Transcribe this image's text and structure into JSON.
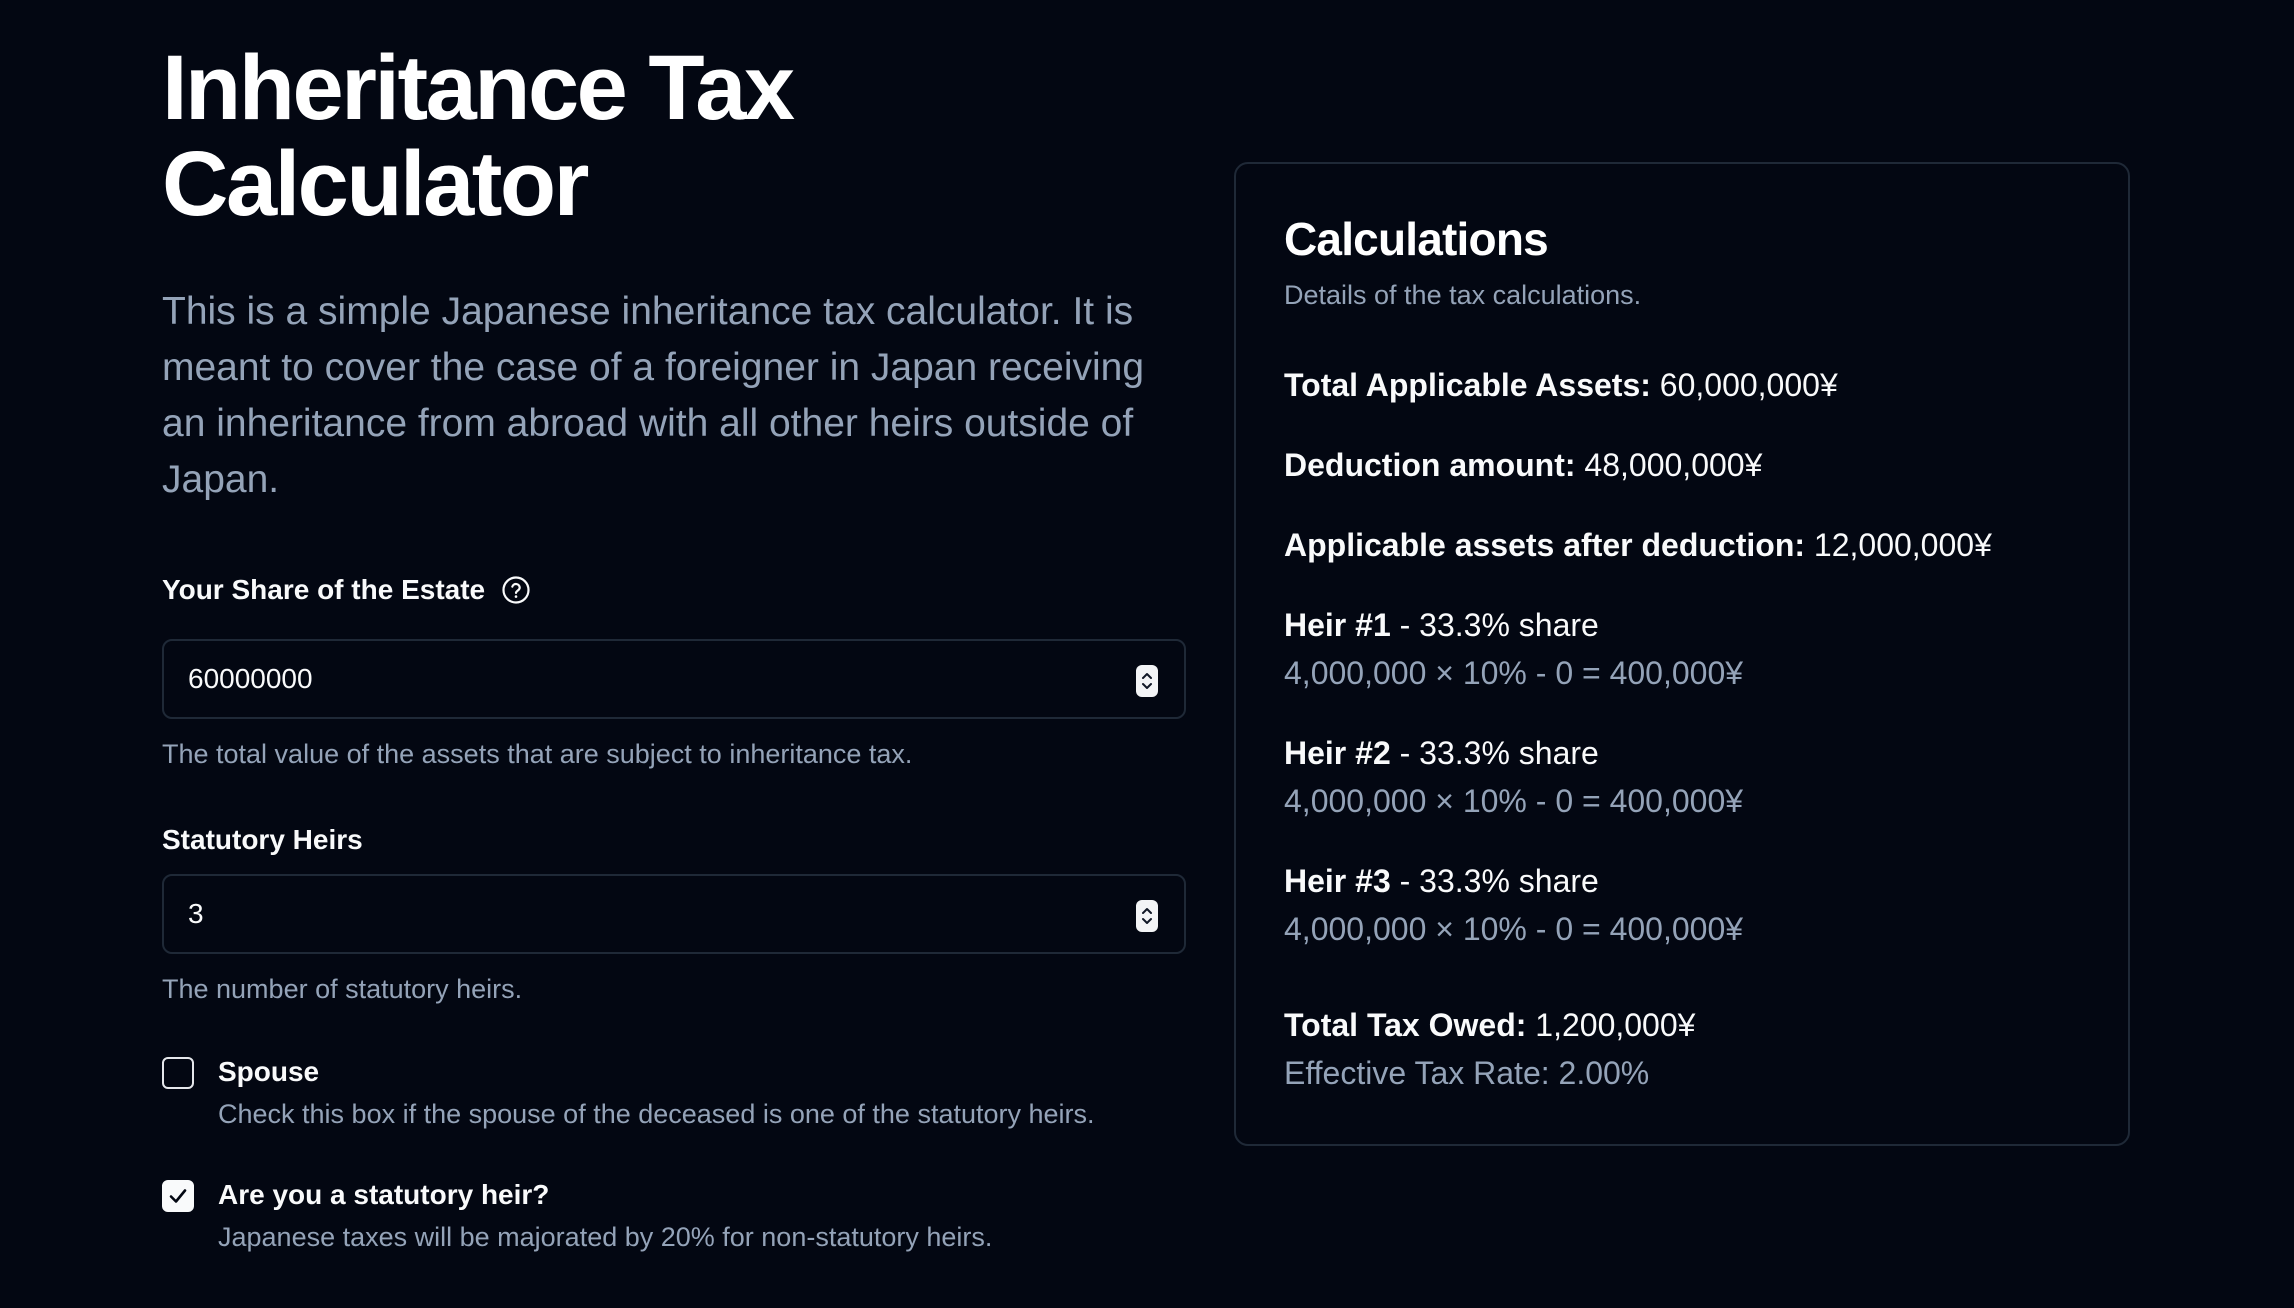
{
  "page": {
    "title": "Inheritance Tax Calculator",
    "intro": "This is a simple Japanese inheritance tax calculator. It is meant to cover the case of a foreigner in Japan receiving an inheritance from abroad with all other heirs outside of Japan."
  },
  "form": {
    "share": {
      "label": "Your Share of the Estate",
      "value": "60000000",
      "description": "The total value of the assets that are subject to inheritance tax."
    },
    "heirs": {
      "label": "Statutory Heirs",
      "value": "3",
      "description": "The number of statutory heirs."
    },
    "spouse": {
      "label": "Spouse",
      "description": "Check this box if the spouse of the deceased is one of the statutory heirs.",
      "checked": false
    },
    "statutory_heir": {
      "label": "Are you a statutory heir?",
      "description": "Japanese taxes will be majorated by 20% for non-statutory heirs.",
      "checked": true
    }
  },
  "calculations": {
    "title": "Calculations",
    "subtitle": "Details of the tax calculations.",
    "total_assets": {
      "label": "Total Applicable Assets:",
      "value": "60,000,000¥"
    },
    "deduction": {
      "label": "Deduction amount:",
      "value": "48,000,000¥"
    },
    "after_deduction": {
      "label": "Applicable assets after deduction:",
      "value": "12,000,000¥"
    },
    "heirs": [
      {
        "name": "Heir #1",
        "share": "- 33.3% share",
        "formula": "4,000,000 × 10% - 0 = 400,000¥"
      },
      {
        "name": "Heir #2",
        "share": "- 33.3% share",
        "formula": "4,000,000 × 10% - 0 = 400,000¥"
      },
      {
        "name": "Heir #3",
        "share": "- 33.3% share",
        "formula": "4,000,000 × 10% - 0 = 400,000¥"
      }
    ],
    "total_tax": {
      "label": "Total Tax Owed:",
      "value": "1,200,000¥"
    },
    "effective_rate": "Effective Tax Rate: 2.00%"
  },
  "icons": {
    "help": "help-circle-icon",
    "spinner": "chevron-up-down-icon",
    "check": "check-icon"
  },
  "colors": {
    "background": "#030712",
    "muted_text": "#94a3b8",
    "border": "#1f2937"
  }
}
